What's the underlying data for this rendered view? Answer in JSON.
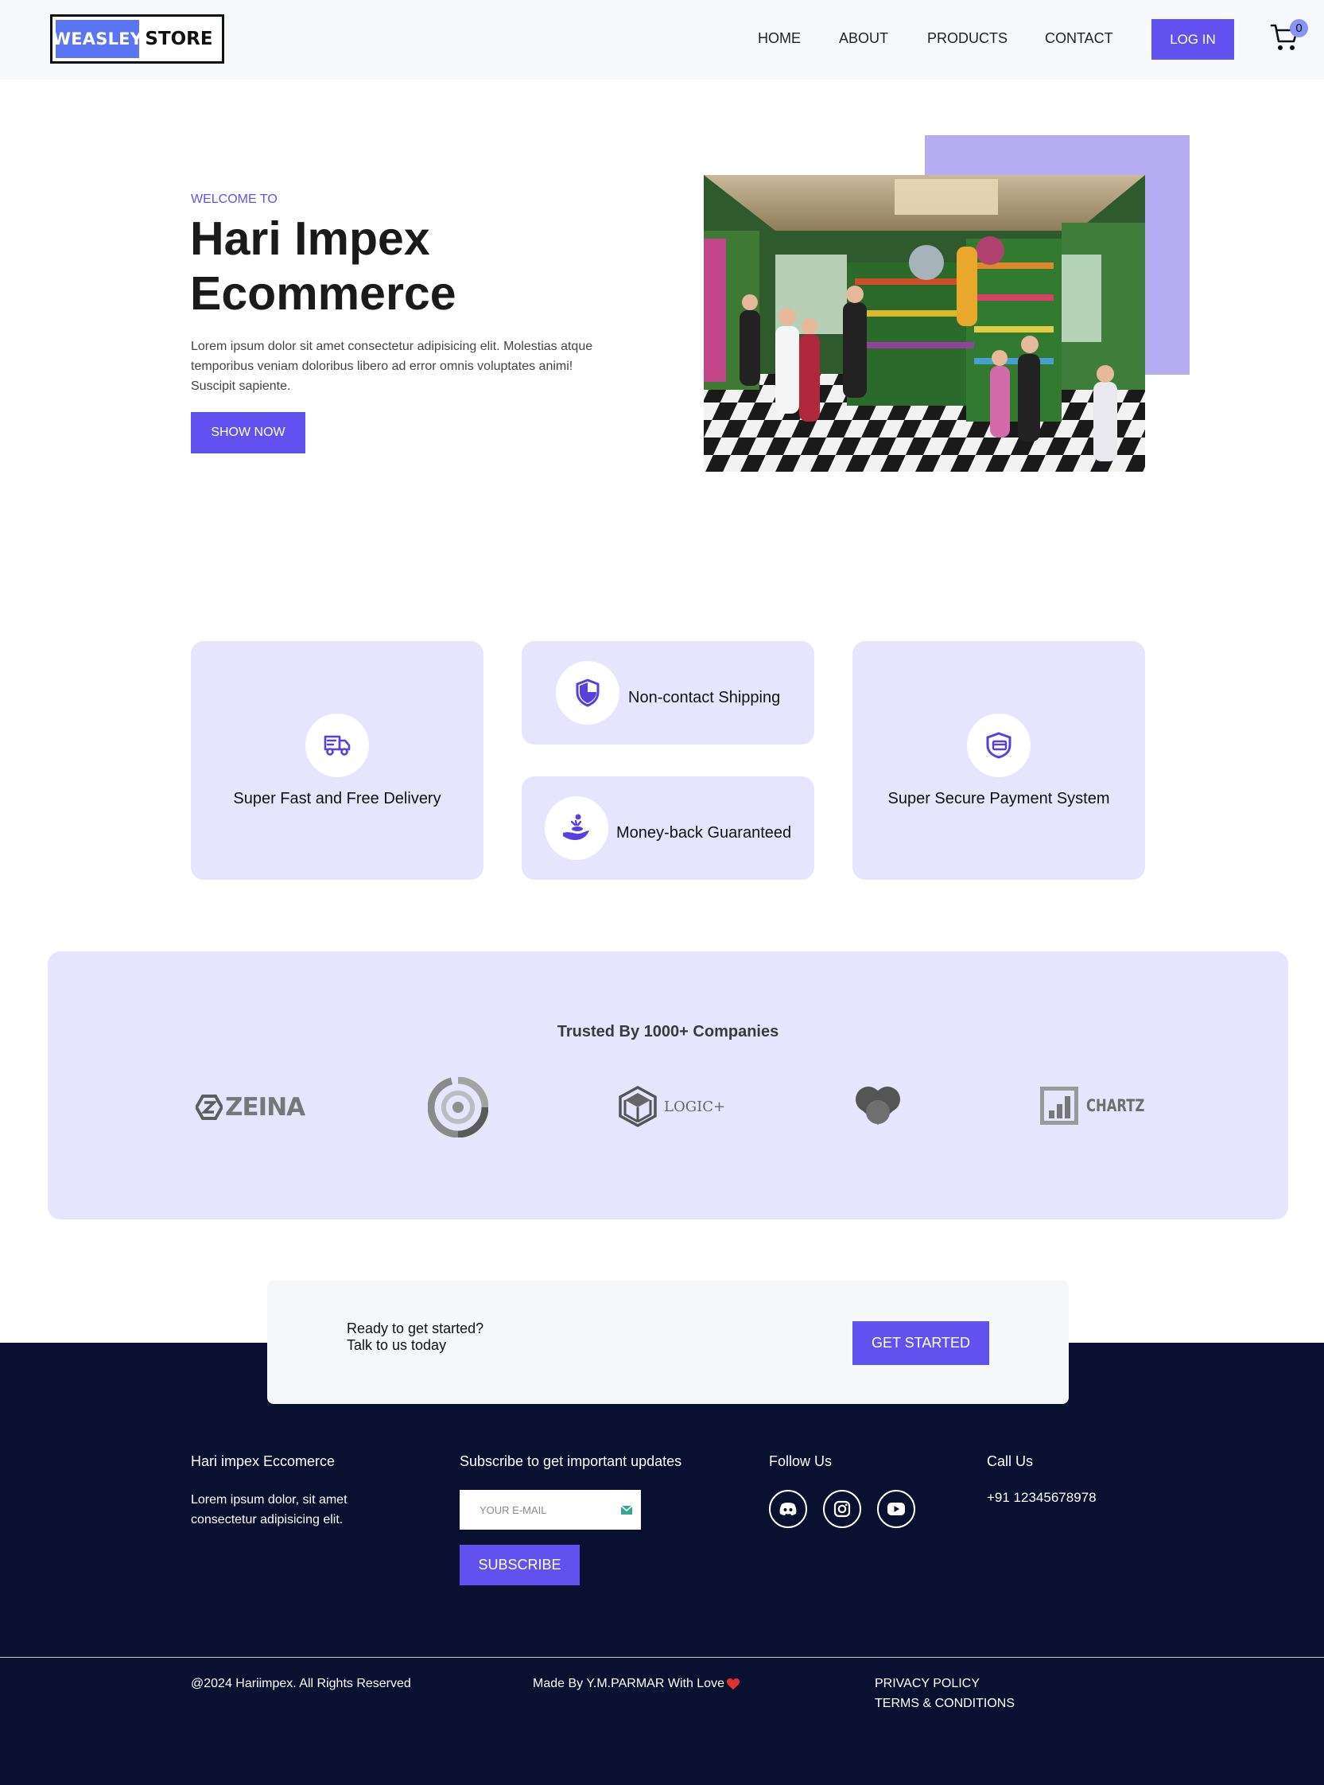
{
  "header": {
    "logo_left": "WEASLEY",
    "logo_right": "STORE",
    "nav": [
      "HOME",
      "ABOUT",
      "PRODUCTS",
      "CONTACT"
    ],
    "login_label": "LOG IN",
    "cart_count": "0"
  },
  "hero": {
    "kicker": "WELCOME TO",
    "title_line1": "Hari Impex",
    "title_line2": "Ecommerce",
    "text": "Lorem ipsum dolor sit amet consectetur adipisicing elit. Molestias atque temporibus veniam doloribus libero ad error omnis voluptates animi! Suscipit sapiente.",
    "button_label": "SHOW NOW",
    "accent_color": "#b6acf4"
  },
  "features": [
    {
      "label": "Super Fast and Free Delivery",
      "icon": "truck-icon"
    },
    {
      "label": "Non-contact Shipping",
      "icon": "shield-icon"
    },
    {
      "label": "Money-back Guaranteed",
      "icon": "hand-coin-icon"
    },
    {
      "label": "Super Secure Payment System",
      "icon": "secure-card-icon"
    }
  ],
  "trusted": {
    "title": "Trusted By 1000+ Companies",
    "brands": [
      "ZEINA",
      "",
      "LOGIC+",
      "",
      "CHARTZ"
    ]
  },
  "cta": {
    "line1": "Ready to get started?",
    "line2": "Talk to us today",
    "button_label": "GET STARTED"
  },
  "footer": {
    "about_title": "Hari impex Eccomerce",
    "about_text": "Lorem ipsum dolor, sit amet consectetur adipisicing elit.",
    "subscribe_title": "Subscribe to get important updates",
    "email_placeholder": "YOUR E-MAIL",
    "subscribe_label": "SUBSCRIBE",
    "follow_title": "Follow Us",
    "call_title": "Call Us",
    "phone": "+91 12345678978",
    "copyright": "@2024 Hariimpex. All Rights Reserved",
    "made_by": "Made By Y.M.PARMAR With Love",
    "privacy": "PRIVACY POLICY",
    "terms": "TERMS & CONDITIONS"
  },
  "colors": {
    "brand": "#6152ef",
    "feature_bg": "#e7e4fd",
    "footer_bg": "#0a1130",
    "header_bg": "#f6f8fa"
  }
}
